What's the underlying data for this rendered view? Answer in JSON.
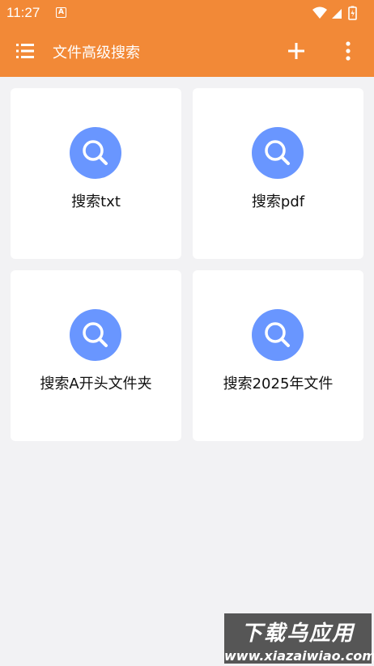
{
  "status": {
    "time": "11:27",
    "notification_badge": "A"
  },
  "toolbar": {
    "title": "文件高级搜索",
    "menu_icon": "list-menu-icon",
    "add_icon": "plus-icon",
    "more_icon": "more-vertical-icon"
  },
  "cards": [
    {
      "label": "搜索txt",
      "icon": "search-icon"
    },
    {
      "label": "搜索pdf",
      "icon": "search-icon"
    },
    {
      "label": "搜索A开头文件夹",
      "icon": "search-icon"
    },
    {
      "label": "搜索2025年文件",
      "icon": "search-icon"
    }
  ],
  "watermark": {
    "title": "下载乌应用",
    "url": "www.xiazaiwiao.com"
  },
  "colors": {
    "appbar": "#f28937",
    "icon_circle": "#6996ff",
    "background": "#f2f2f4"
  }
}
